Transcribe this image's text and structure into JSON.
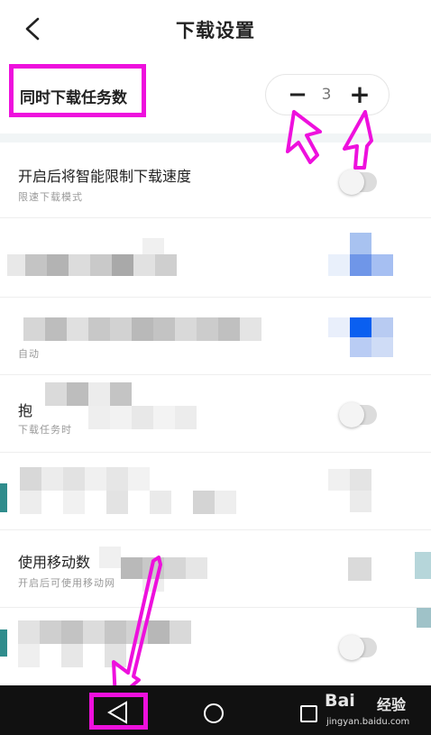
{
  "header": {
    "title": "下载设置",
    "back_icon": "chevron-left-icon"
  },
  "concurrent": {
    "label": "同时下载任务数",
    "minus": "−",
    "value": "3",
    "plus": "+"
  },
  "settings": [
    {
      "title": "开启后将智能限制下载速度",
      "subtitle": "限速下载模式",
      "toggle_on": false
    },
    {
      "title": "",
      "subtitle": ""
    },
    {
      "title": "",
      "subtitle": "自动"
    },
    {
      "title": "抱",
      "subtitle": "下载任务时",
      "toggle_on": false
    },
    {
      "title": "",
      "subtitle": ""
    },
    {
      "title": "使用移动数",
      "subtitle": "开启后可使用移动网"
    },
    {
      "title": "",
      "subtitle": ""
    }
  ],
  "navbar": {
    "back_icon": "triangle-back-icon",
    "home_icon": "circle-home-icon",
    "recent_icon": "square-recent-icon"
  },
  "watermark": {
    "brand": "Bai",
    "brand_cn": "经验",
    "url": "jingyan.baidu.com"
  },
  "colors": {
    "annotation": "#ee10dd",
    "navbar_bg": "#111111",
    "section_gap": "#f1f5f6",
    "toggle_track": "#dcdcdc"
  }
}
